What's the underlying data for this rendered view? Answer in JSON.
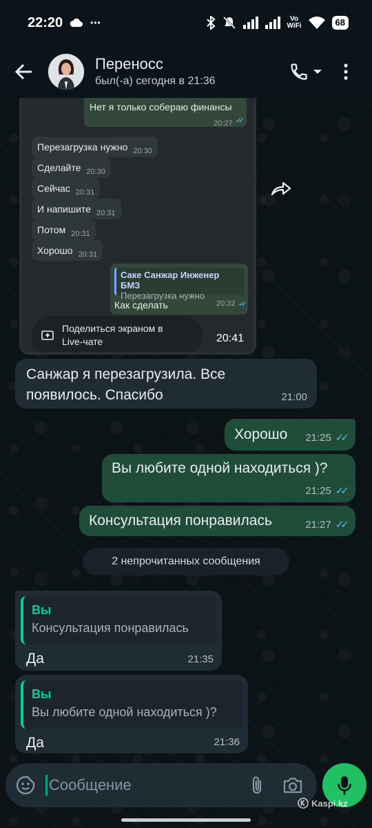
{
  "status_bar": {
    "time": "22:20",
    "dots": "•••",
    "volte_top": "Vo",
    "volte_bottom": "WiFi",
    "battery": "68"
  },
  "header": {
    "contact_name": "Переносс",
    "last_seen": "был(-а) сегодня в 21:36"
  },
  "image_message": {
    "mini_messages": [
      {
        "text": "Нет я только собераю финансы",
        "time": "20:27",
        "dir": "out"
      },
      {
        "text": "Перезагрузка нужно",
        "time": "20:30",
        "dir": "in"
      },
      {
        "text": "Сделайте",
        "time": "20:30",
        "dir": "in"
      },
      {
        "text": "Сейчас",
        "time": "20:31",
        "dir": "in"
      },
      {
        "text": "И напишите",
        "time": "20:31",
        "dir": "in"
      },
      {
        "text": "Потом",
        "time": "20:31",
        "dir": "in"
      },
      {
        "text": "Хорошо",
        "time": "20:31",
        "dir": "in"
      }
    ],
    "reply": {
      "quote_name": "Саке Санжар Инженер БМЗ",
      "quote_text": "Перезагрузка нужно",
      "text": "Как сделать",
      "time": "20:32"
    },
    "share_label": "Поделиться экраном в Live-чате",
    "time": "20:41"
  },
  "messages": [
    {
      "text": "Санжар я перезагрузила. Все появилось. Спасибо",
      "time": "21:00"
    },
    {
      "text": "Хорошо",
      "time": "21:25"
    },
    {
      "text": "Вы любите одной находиться )?",
      "time": "21:25"
    },
    {
      "text": "Консультация понравилась",
      "time": "21:27"
    }
  ],
  "unread_banner": "2 непрочитанных сообщения",
  "replies": [
    {
      "quote_name": "Вы",
      "quote_text": "Консультация понравилась",
      "text": "Да",
      "time": "21:35"
    },
    {
      "quote_name": "Вы",
      "quote_text": "Вы любите одной находиться )?",
      "text": "Да",
      "time": "21:36"
    }
  ],
  "input": {
    "placeholder": "Сообщение"
  },
  "watermark": "Kaspi.kz",
  "colors": {
    "accent": "#00a884",
    "outgoing_bubble": "#1f4d3a",
    "incoming_bubble": "#202c33",
    "read_ticks": "#53bdeb",
    "mic_button": "#21c063"
  }
}
